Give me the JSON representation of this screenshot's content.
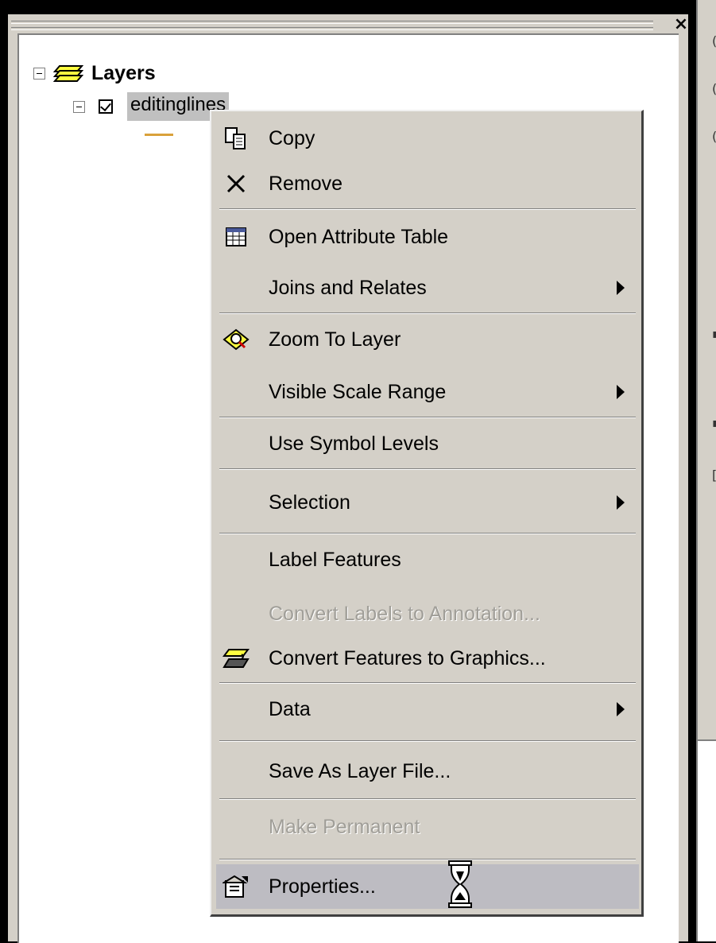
{
  "toc": {
    "close_symbol": "×",
    "root_label": "Layers",
    "root_icon": "layers-stack-icon",
    "layer_name": "editinglines",
    "layer_checked": true
  },
  "context_menu": {
    "items": [
      {
        "label": "Copy",
        "icon": "copy-icon",
        "enabled": true
      },
      {
        "label": "Remove",
        "icon": "remove-x-icon",
        "enabled": true
      },
      {
        "label": "Open Attribute Table",
        "icon": "table-icon",
        "enabled": true
      },
      {
        "label": "Joins and Relates",
        "icon": "",
        "enabled": true,
        "submenu": true
      },
      {
        "label": "Zoom To Layer",
        "icon": "zoom-to-layer-icon",
        "enabled": true
      },
      {
        "label": "Visible Scale Range",
        "icon": "",
        "enabled": true,
        "submenu": true
      },
      {
        "label": "Use Symbol Levels",
        "icon": "",
        "enabled": true
      },
      {
        "label": "Selection",
        "icon": "",
        "enabled": true,
        "submenu": true
      },
      {
        "label": "Label Features",
        "icon": "",
        "enabled": true
      },
      {
        "label": "Convert Labels to Annotation...",
        "icon": "",
        "enabled": false
      },
      {
        "label": "Convert Features to Graphics...",
        "icon": "convert-graphics-icon",
        "enabled": true
      },
      {
        "label": "Data",
        "icon": "",
        "enabled": true,
        "submenu": true
      },
      {
        "label": "Save As Layer File...",
        "icon": "",
        "enabled": true
      },
      {
        "label": "Make Permanent",
        "icon": "",
        "enabled": false
      },
      {
        "label": "Properties...",
        "icon": "properties-icon",
        "enabled": true,
        "highlighted": true
      }
    ]
  },
  "cursor": "hourglass-cursor-icon",
  "colors": {
    "menu_bg": "#d4d0c8",
    "highlight": "#bdbcc2",
    "disabled_text": "#a09e98",
    "symbol_line": "#d9a13b"
  }
}
